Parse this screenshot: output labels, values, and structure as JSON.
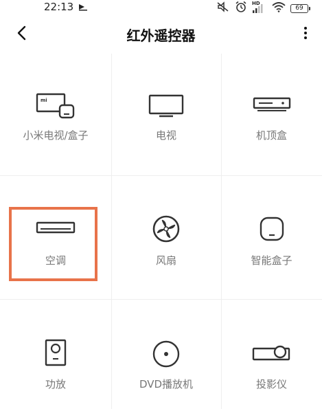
{
  "status_bar": {
    "time": "22:13",
    "battery": "69",
    "network": "HD",
    "icons": [
      "silent-icon",
      "alarm-icon",
      "signal-icon",
      "wifi-icon",
      "battery-icon"
    ]
  },
  "header": {
    "title": "红外遥控器",
    "back_icon": "back-arrow-icon",
    "more_icon": "more-vertical-icon"
  },
  "devices": [
    {
      "label": "小米电视/盒子",
      "icon": "mi-tv-box-icon"
    },
    {
      "label": "电视",
      "icon": "tv-icon"
    },
    {
      "label": "机顶盒",
      "icon": "set-top-box-icon"
    },
    {
      "label": "空调",
      "icon": "air-conditioner-icon",
      "highlighted": true
    },
    {
      "label": "风扇",
      "icon": "fan-icon"
    },
    {
      "label": "智能盒子",
      "icon": "smart-box-icon"
    },
    {
      "label": "功放",
      "icon": "amplifier-icon"
    },
    {
      "label": "DVD播放机",
      "icon": "dvd-player-icon"
    },
    {
      "label": "投影仪",
      "icon": "projector-icon"
    }
  ],
  "colors": {
    "highlight": "#e8734a",
    "icon": "#333333",
    "label": "#777777"
  }
}
